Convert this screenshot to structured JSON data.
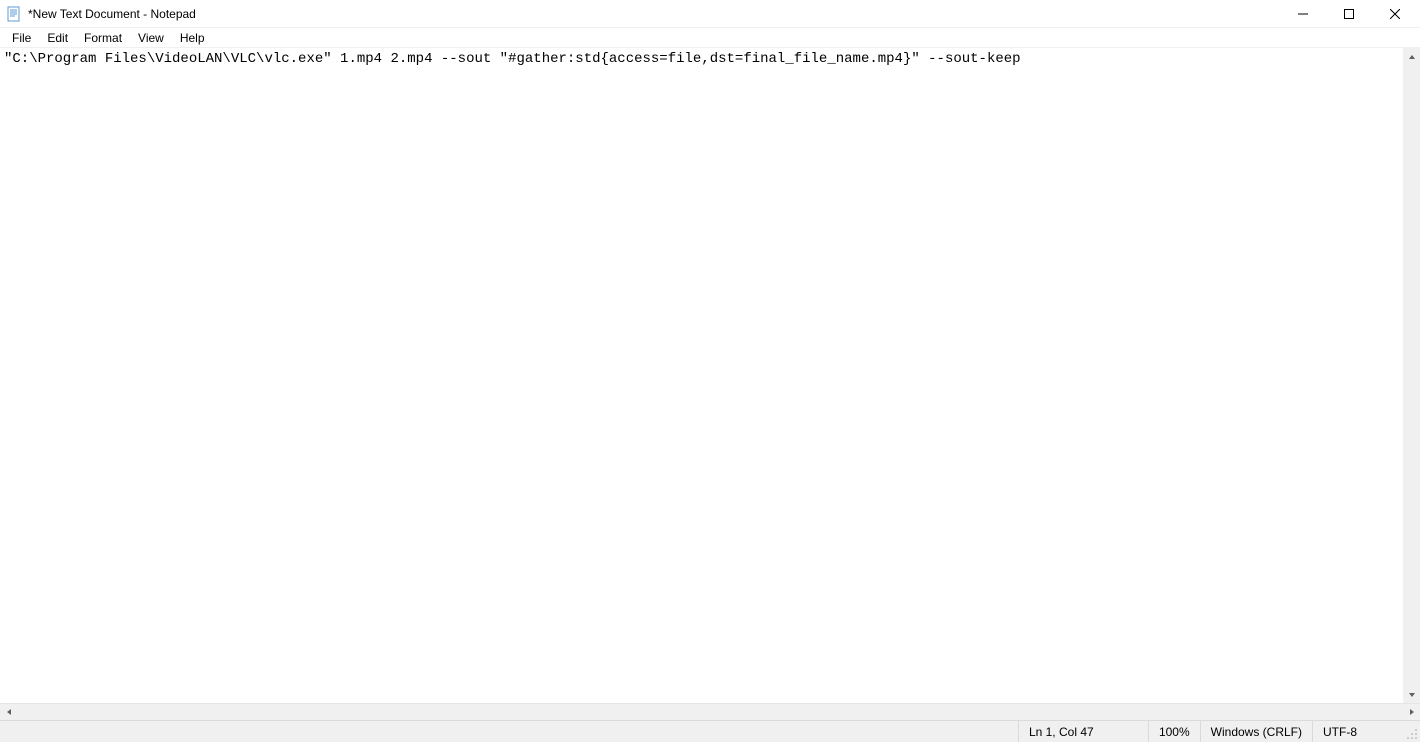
{
  "window": {
    "title": "*New Text Document - Notepad"
  },
  "menu": {
    "file": "File",
    "edit": "Edit",
    "format": "Format",
    "view": "View",
    "help": "Help"
  },
  "editor": {
    "content": "\"C:\\Program Files\\VideoLAN\\VLC\\vlc.exe\" 1.mp4 2.mp4 --sout \"#gather:std{access=file,dst=final_file_name.mp4}\" --sout-keep"
  },
  "statusbar": {
    "position": "Ln 1, Col 47",
    "zoom": "100%",
    "eol": "Windows (CRLF)",
    "encoding": "UTF-8"
  }
}
